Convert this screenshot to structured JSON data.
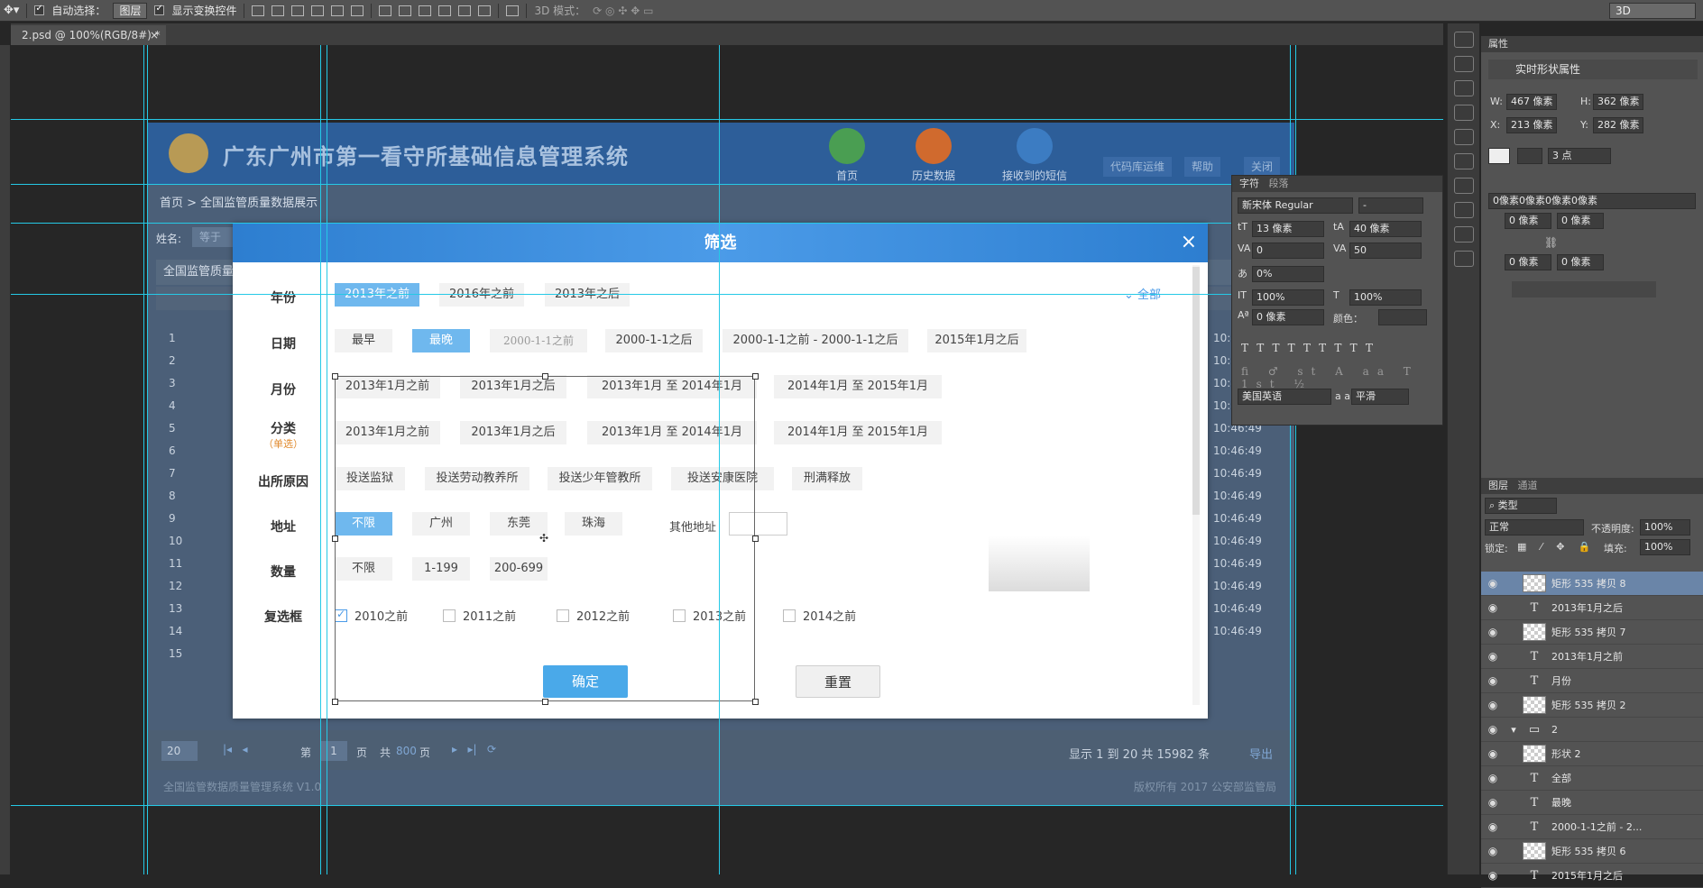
{
  "toolbar": {
    "auto_select": "自动选择：",
    "layer_select": "图层",
    "show_transform": "显示变换控件",
    "mode3d": "3D 模式：",
    "workspace": "3D"
  },
  "doc_tab": "2.psd @ 100%(RGB/8#) *",
  "doc_tab_close": "×",
  "page": {
    "title": "广东广州市第一看守所基础信息管理系统",
    "nav": [
      "首页",
      "历史数据",
      "接收到的短信"
    ],
    "nav_colors": [
      "#4a9e52",
      "#d06a2e",
      "#3c7cc2"
    ],
    "header_buttons": [
      "代码库运维",
      "帮助",
      "关闭"
    ],
    "breadcrumb": "首页 > 全国监管质量数据展示",
    "name_label": "姓名:",
    "name_value": "等于",
    "table_title": "全国监管质量",
    "row_nums": [
      "1",
      "2",
      "3",
      "4",
      "5",
      "6",
      "7",
      "8",
      "9",
      "10",
      "11",
      "12",
      "13",
      "14",
      "15"
    ],
    "time": "10:46:49",
    "page_size": "20",
    "pager_text": [
      "第",
      "1",
      "页",
      "共",
      "800",
      "页"
    ],
    "summary": "显示 1 到 20 共 15982 条",
    "export": "导出",
    "footer_left": "全国监管数据质量管理系统 V1.0",
    "footer_right": "版权所有 2017 公安部监管局"
  },
  "dialog": {
    "title": "筛选",
    "close": "×",
    "labels": {
      "year": "年份",
      "date": "日期",
      "month": "月份",
      "category": "分类",
      "category_sub": "（单选）",
      "reason": "出所原因",
      "address": "地址",
      "quantity": "数量",
      "checkbox": "复选框"
    },
    "year_opts": [
      "2013年之前",
      "2016年之前",
      "2013年之后"
    ],
    "date_opts": [
      "最早",
      "最晚",
      "2000-1-1之前",
      "2000-1-1之后",
      "2000-1-1之前 - 2000-1-1之后",
      "2015年1月之后"
    ],
    "all": "全部",
    "month_opts": [
      "2013年1月之前",
      "2013年1月之后",
      "2013年1月 至 2014年1月",
      "2014年1月 至 2015年1月"
    ],
    "category_opts": [
      "2013年1月之前",
      "2013年1月之后",
      "2013年1月 至 2014年1月",
      "2014年1月 至 2015年1月"
    ],
    "reason_opts": [
      "投送监狱",
      "投送劳动教养所",
      "投送少年管教所",
      "投送安康医院",
      "刑满释放"
    ],
    "address_opts": [
      "不限",
      "广州",
      "东莞",
      "珠海"
    ],
    "other_address": "其他地址",
    "quantity_opts": [
      "不限",
      "1-199",
      "200-699"
    ],
    "check_opts": [
      "2010之前",
      "2011之前",
      "2012之前",
      "2013之前",
      "2014之前"
    ],
    "ok": "确定",
    "reset": "重置"
  },
  "props": {
    "tab": "属性",
    "title": "实时形状属性",
    "w_label": "W:",
    "w": "467 像素",
    "h_label": "H:",
    "h": "362 像素",
    "x_label": "X:",
    "x": "213 像素",
    "y_label": "Y:",
    "y": "282 像素",
    "stroke": "3 点",
    "radius_all": "0像素0像素0像素0像素",
    "r1": "0 像素",
    "r2": "0 像素",
    "r3": "0 像素",
    "r4": "0 像素"
  },
  "char": {
    "tabs": [
      "字符",
      "段落"
    ],
    "font": "新宋体 Regular",
    "style": "-",
    "size": "13 像素",
    "leading": "40 像素",
    "kern": "0",
    "track": "50",
    "scale_pct": "0%",
    "vscale": "100%",
    "hscale": "100%",
    "baseline": "0 像素",
    "color_label": "颜色：",
    "lang": "美国英语",
    "aa_label": "a a",
    "aa": "平滑"
  },
  "layers": {
    "tabs": [
      "图层",
      "通道"
    ],
    "kind": "类型",
    "blend": "正常",
    "opacity_label": "不透明度:",
    "opacity": "100%",
    "lock_label": "锁定:",
    "fill_label": "填充:",
    "fill": "100%",
    "items": [
      {
        "type": "shape",
        "name": "矩形 535 拷贝 8",
        "selected": true
      },
      {
        "type": "text",
        "name": "2013年1月之后"
      },
      {
        "type": "shape",
        "name": "矩形 535 拷贝 7"
      },
      {
        "type": "text",
        "name": "2013年1月之前"
      },
      {
        "type": "text",
        "name": "月份"
      },
      {
        "type": "shape",
        "name": "矩形 535 拷贝 2"
      },
      {
        "type": "group",
        "name": "2"
      },
      {
        "type": "shape",
        "name": "形状 2"
      },
      {
        "type": "text",
        "name": "全部"
      },
      {
        "type": "text",
        "name": "最晚"
      },
      {
        "type": "text",
        "name": "2000-1-1之前 - 2..."
      },
      {
        "type": "shape",
        "name": "矩形 535 拷贝 6"
      },
      {
        "type": "text",
        "name": "2015年1月之后"
      }
    ]
  }
}
